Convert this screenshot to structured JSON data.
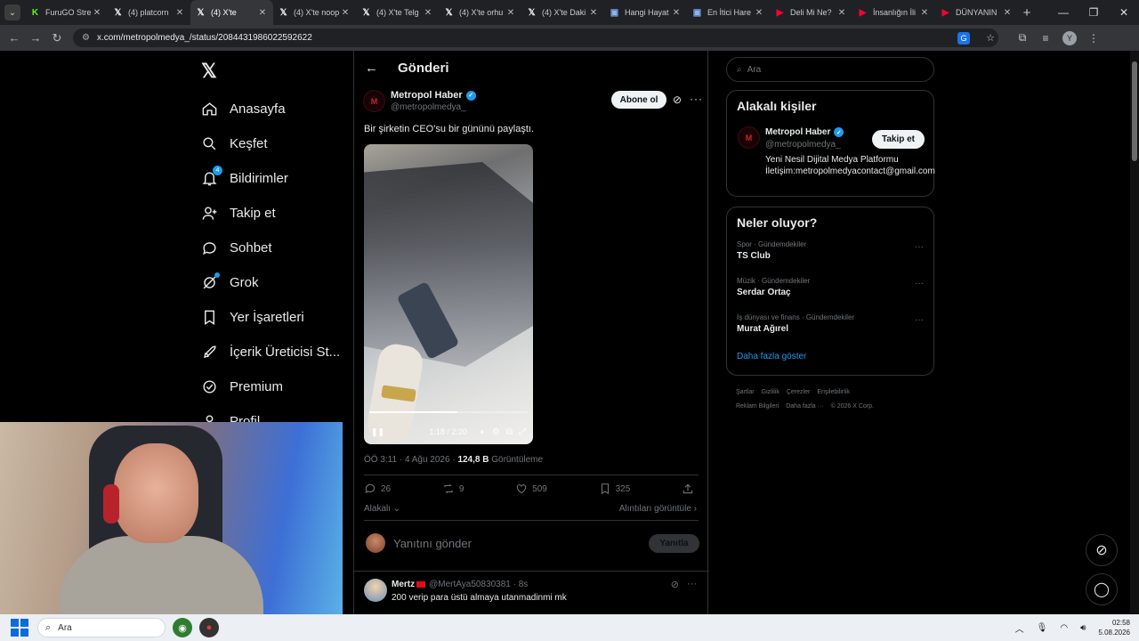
{
  "browser": {
    "tabs": [
      {
        "label": "FuruGO Stre",
        "icon": "kick-icon",
        "color": "#53fc18"
      },
      {
        "label": "(4) platcorn",
        "icon": "x-icon",
        "color": "#ffffff"
      },
      {
        "label": "(4) X'te",
        "icon": "x-icon",
        "color": "#ffffff",
        "active": true
      },
      {
        "label": "(4) X'te noop",
        "icon": "x-icon",
        "color": "#ffffff"
      },
      {
        "label": "(4) X'te Telg",
        "icon": "x-icon",
        "color": "#ffffff"
      },
      {
        "label": "(4) X'te orhu",
        "icon": "x-icon",
        "color": "#ffffff"
      },
      {
        "label": "(4) X'te Daki",
        "icon": "x-icon",
        "color": "#ffffff"
      },
      {
        "label": "Hangi Hayat",
        "icon": "folder-icon",
        "color": "#8ab4f8"
      },
      {
        "label": "En İtici Hare",
        "icon": "folder-icon",
        "color": "#8ab4f8"
      },
      {
        "label": "Deli Mi Ne?",
        "icon": "youtube-icon",
        "color": "#ff0033"
      },
      {
        "label": "İnsanlığın İli",
        "icon": "youtube-icon",
        "color": "#ff0033"
      },
      {
        "label": "DÜNYANIN",
        "icon": "youtube-icon",
        "color": "#ff0033"
      }
    ],
    "url": "x.com/metropolmedya_/status/2084431986022592622",
    "profile_initial": "Y"
  },
  "sidebar": {
    "items": [
      {
        "label": "Anasayfa",
        "icon": "home-icon"
      },
      {
        "label": "Keşfet",
        "icon": "search-icon"
      },
      {
        "label": "Bildirimler",
        "icon": "bell-icon",
        "badge": "4"
      },
      {
        "label": "Takip et",
        "icon": "person-add-icon"
      },
      {
        "label": "Sohbet",
        "icon": "chat-icon"
      },
      {
        "label": "Grok",
        "icon": "grok-icon"
      },
      {
        "label": "Yer İşaretleri",
        "icon": "bookmark-icon"
      },
      {
        "label": "İçerik Üreticisi St...",
        "icon": "rocket-icon"
      },
      {
        "label": "Premium",
        "icon": "premium-icon"
      },
      {
        "label": "Profil",
        "icon": "profile-icon"
      }
    ]
  },
  "main": {
    "header_title": "Gönderi",
    "author_name": "Metropol Haber",
    "author_handle": "@metropolmedya_",
    "subscribe_label": "Abone ol",
    "text": "Bir şirketin CEO'su bir gününü paylaştı.",
    "video_time": "1:18 / 2:20",
    "video_progress": 0.557,
    "timestamp": "ÖÖ 3:11 · 4 Ağu 2026 ·",
    "views": "124,8 B",
    "views_label": "Görüntüleme",
    "replies": "26",
    "reposts": "9",
    "likes": "509",
    "bookmarks": "325",
    "related_label": "Alakalı",
    "quotes_label": "Alıntıları görüntüle",
    "reply_placeholder": "Yanıtını gönder",
    "reply_button": "Yanıtla",
    "reply_post": {
      "name": "Mertz",
      "handle": "@MertAya50830381 · 8s",
      "text": "200 verip para üstü almaya utanmadinmi mk"
    }
  },
  "right": {
    "search_placeholder": "Ara",
    "related_title": "Alakalı kişiler",
    "person_name": "Metropol Haber",
    "person_handle": "@metropolmedya_",
    "follow_label": "Takip et",
    "person_bio": "Yeni Nesil Dijital Medya Platformu İletişim:metropolmedyacontact@gmail.com",
    "trends_title": "Neler oluyor?",
    "trends": [
      {
        "category": "Spor · Gündemdekiler",
        "title": "TS Club"
      },
      {
        "category": "Müzik · Gündemdekiler",
        "title": "Serdar Ortaç"
      },
      {
        "category": "İş dünyası ve finans · Gündemdekiler",
        "title": "Murat Ağırel"
      }
    ],
    "show_more": "Daha fazla göster",
    "footer": [
      "Şartlar",
      "Gizlilik",
      "Çerezler",
      "Erişilebilirlik",
      "Reklam Bilgileri",
      "Daha fazla ···",
      "© 2026 X Corp."
    ]
  },
  "taskbar": {
    "search_placeholder": "Ara",
    "time": "02:58",
    "date": "5.08.2026"
  },
  "colors": {
    "accent": "#1d9bf0",
    "background": "#000000",
    "muted": "#71767b"
  }
}
